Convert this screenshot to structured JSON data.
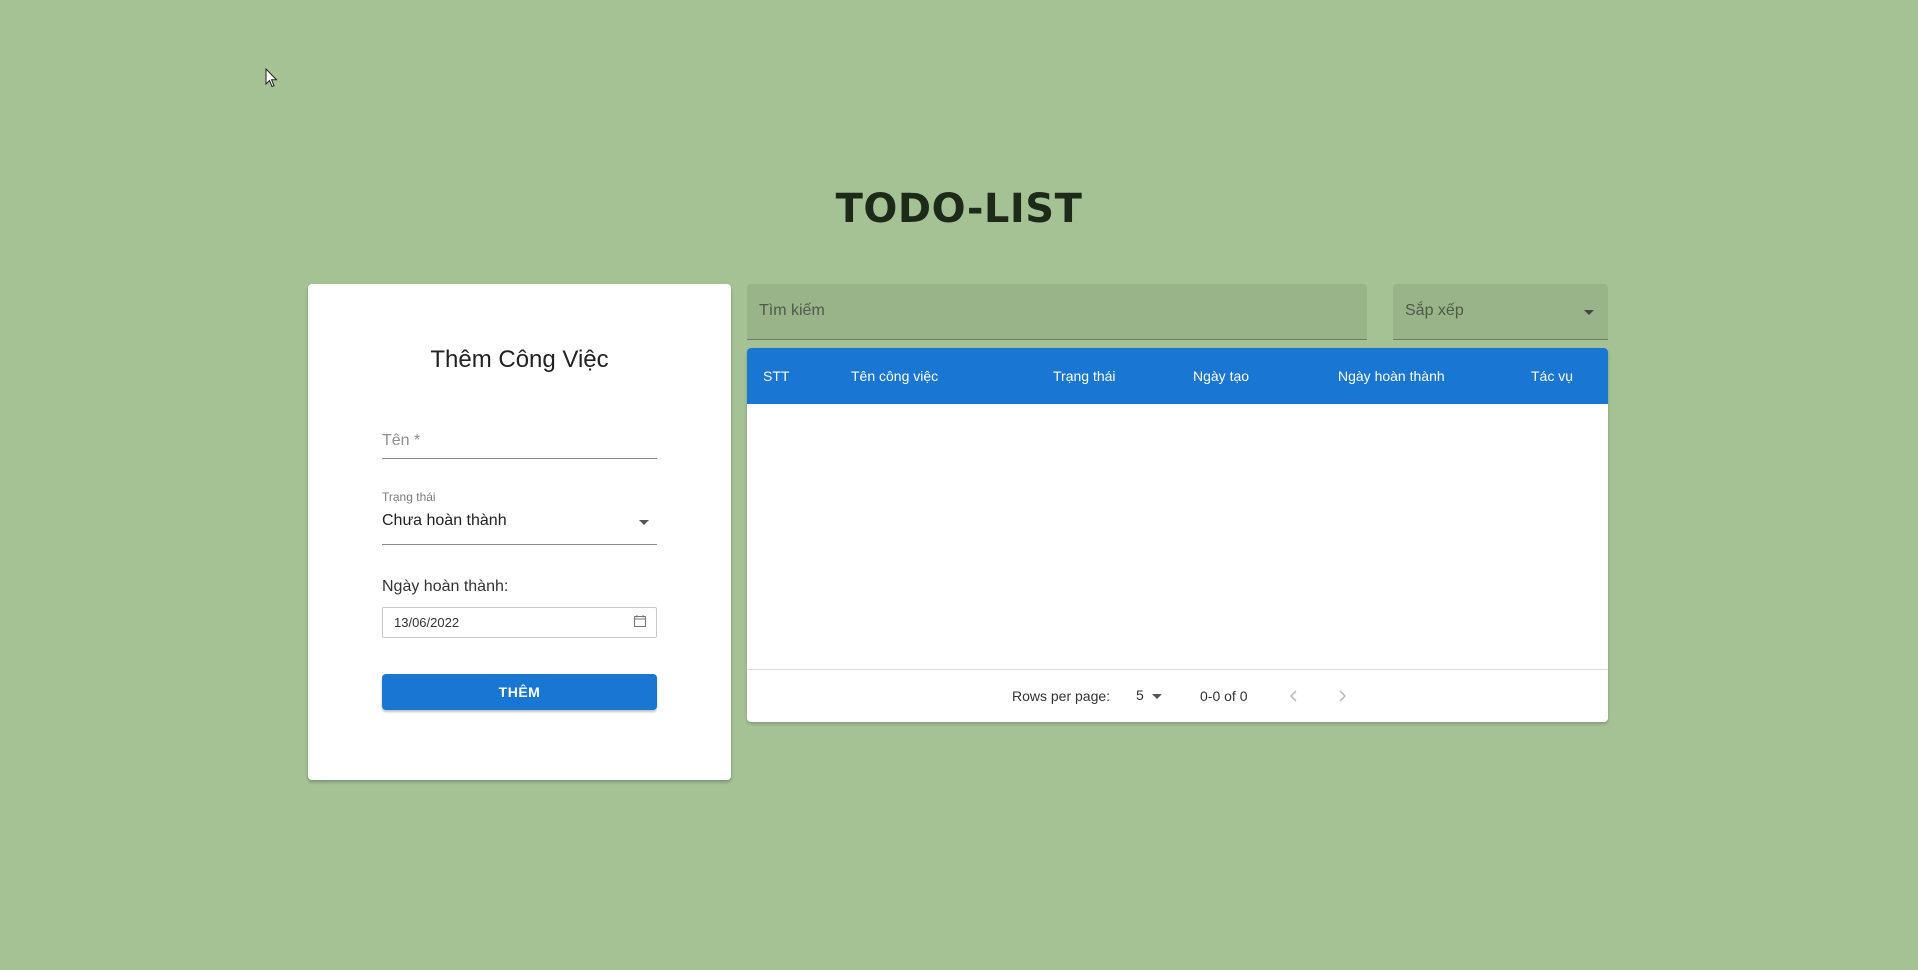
{
  "title": "TODO-LIST",
  "add_form": {
    "heading": "Thêm Công Việc",
    "name_placeholder": "Tên *",
    "status_label": "Trạng thái",
    "status_value": "Chưa hoàn thành",
    "due_label": "Ngày hoàn thành:",
    "due_value": "13/06/2022",
    "submit_label": "THÊM"
  },
  "toolbar": {
    "search_placeholder": "Tìm kiếm",
    "sort_placeholder": "Sắp xếp"
  },
  "table": {
    "columns": [
      "STT",
      "Tên công việc",
      "Trạng thái",
      "Ngày tạo",
      "Ngày hoàn thành",
      "Tác vụ"
    ],
    "rows": []
  },
  "pagination": {
    "rows_per_page_label": "Rows per page:",
    "rows_per_page": "5",
    "range": "0-0 of 0"
  },
  "colors": {
    "background": "#a5c295",
    "accent": "#1976d2",
    "input_fill": "#98b488"
  },
  "icons": {
    "cursor": "mouse-pointer-icon",
    "status_caret": "chevron-down-icon",
    "calendar": "calendar-icon",
    "prev": "chevron-left-icon",
    "next": "chevron-right-icon"
  }
}
